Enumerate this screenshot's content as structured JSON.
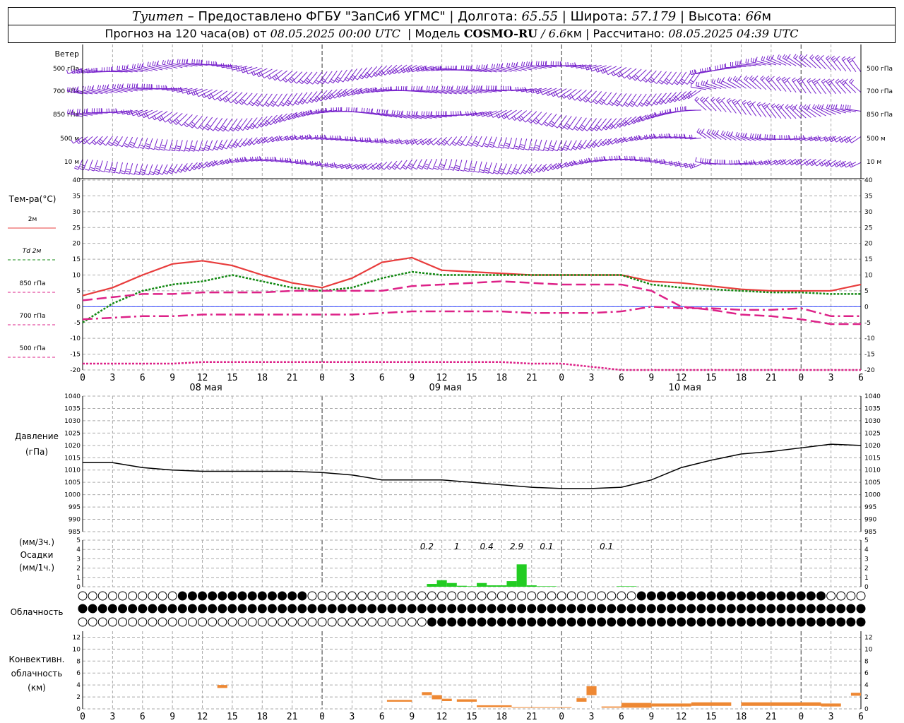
{
  "header": {
    "station": "Tyumen",
    "provider": "– Предоставлено ФГБУ \"ЗапСиб УГМС\"",
    "lon_label": "Долгота:",
    "lon": "65.55",
    "lat_label": "Широта:",
    "lat": "57.179",
    "alt_label": "Высота:",
    "alt": "66",
    "alt_unit": "м"
  },
  "subheader": {
    "forecast_label": "Прогноз на 120 часа(ов) от",
    "init": "08.05.2025 00:00 UTC",
    "model_label": "Модель",
    "model": "COSMO-RU",
    "resolution": "/ 6.6",
    "res_unit": "км",
    "calc_label": "Рассчитано:",
    "calc": "08.05.2025 04:39 UTC"
  },
  "panels": {
    "wind": {
      "title": "Ветер",
      "levels": [
        "500 гПа",
        "700 гПа",
        "850 гПа",
        "500 м",
        "10 м"
      ]
    },
    "temp": {
      "title": "Тем-ра(°C)",
      "legend": [
        "2м",
        "Td 2м",
        "850 гПа",
        "700 гПа",
        "500 гПа"
      ]
    },
    "pressure": {
      "title": "Давление",
      "unit": "(гПа)"
    },
    "precip": {
      "unit3h": "(мм/3ч.)",
      "title": "Осадки",
      "unit1h": "(мм/1ч.)"
    },
    "cloud": {
      "title": "Облачность"
    },
    "conv": {
      "title1": "Конвективн.",
      "title2": "облачность",
      "unit": "(км)"
    }
  },
  "x_ticks": [
    "0",
    "3",
    "6",
    "9",
    "12",
    "15",
    "18",
    "21",
    "0",
    "3",
    "6",
    "9",
    "12",
    "15",
    "18",
    "21",
    "0",
    "3",
    "6",
    "9",
    "12",
    "15",
    "18",
    "21",
    "0",
    "3",
    "6"
  ],
  "date_labels": [
    "08 мая",
    "09 мая",
    "10 мая"
  ],
  "colors": {
    "t2m": "#e83c3c",
    "td": "#118811",
    "lvl": "#dd2288",
    "wind": "#7722cc",
    "precip": "#22cc22",
    "conv": "#ee8833"
  },
  "chart_data": [
    {
      "type": "line",
      "name": "temperature",
      "ylim": [
        -20,
        40
      ],
      "yticks": [
        40,
        35,
        30,
        25,
        20,
        15,
        10,
        5,
        0,
        -5,
        -10,
        -15,
        -20
      ],
      "x": [
        0,
        3,
        6,
        9,
        12,
        15,
        18,
        21,
        24,
        27,
        30,
        33,
        36,
        39,
        42,
        45,
        48,
        51,
        54,
        57,
        60,
        63,
        66,
        69,
        72,
        75,
        78
      ],
      "series": [
        {
          "name": "2м",
          "values": [
            3.5,
            6,
            10,
            13.5,
            14.5,
            13,
            10,
            7.5,
            6,
            9,
            14,
            15.5,
            11.5,
            11,
            10.5,
            10,
            10,
            10,
            10,
            8,
            7.5,
            6.5,
            5.5,
            5,
            5,
            5,
            7
          ]
        },
        {
          "name": "Td 2м",
          "values": [
            -5,
            1,
            5,
            7,
            8,
            10,
            8,
            6,
            5,
            6,
            9,
            11,
            10,
            10,
            10,
            10,
            10,
            10,
            10,
            7,
            6,
            5.5,
            5,
            4.5,
            4.5,
            4,
            4
          ]
        },
        {
          "name": "850 гПа",
          "values": [
            2,
            3,
            4,
            4,
            4.5,
            4.5,
            4.5,
            5,
            5,
            5,
            5,
            6.5,
            7,
            7.5,
            8,
            7.5,
            7,
            7,
            7,
            5,
            0,
            -1,
            -2.5,
            -3,
            -4,
            -5.5,
            -5.5
          ]
        },
        {
          "name": "700 гПа",
          "values": [
            -4,
            -3.5,
            -3,
            -3,
            -2.5,
            -2.5,
            -2.5,
            -2.5,
            -2.5,
            -2.5,
            -2,
            -1.5,
            -1.5,
            -1.5,
            -1.5,
            -2,
            -2,
            -2,
            -1.5,
            0,
            -0.5,
            -0.5,
            -1,
            -1,
            -0.5,
            -3,
            -3
          ]
        },
        {
          "name": "500 гПа",
          "values": [
            -18,
            -18,
            -18,
            -18,
            -17.5,
            -17.5,
            -17.5,
            -17.5,
            -17.5,
            -17.5,
            -17.5,
            -17.5,
            -17.5,
            -17.5,
            -17.5,
            -18,
            -18,
            -19,
            -20,
            -20.5,
            -21,
            -21,
            -21,
            -21,
            -21,
            -21,
            -21
          ]
        }
      ]
    },
    {
      "type": "line",
      "name": "pressure",
      "ylim": [
        985,
        1040
      ],
      "yticks": [
        1040,
        1035,
        1030,
        1025,
        1020,
        1015,
        1010,
        1005,
        1000,
        995,
        990,
        985
      ],
      "x": [
        0,
        3,
        6,
        9,
        12,
        15,
        18,
        21,
        24,
        27,
        30,
        33,
        36,
        39,
        42,
        45,
        48,
        51,
        54,
        57,
        60,
        63,
        66,
        69,
        72,
        75,
        78
      ],
      "values": [
        1013,
        1013,
        1011,
        1010,
        1009.5,
        1009.5,
        1009.5,
        1009.5,
        1009,
        1008,
        1006,
        1006,
        1006,
        1005,
        1004,
        1003,
        1002.5,
        1002.5,
        1003,
        1006,
        1011,
        1014,
        1016.5,
        1017.5,
        1019,
        1020.5,
        1020
      ]
    },
    {
      "type": "bar",
      "name": "precipitation",
      "ylim": [
        0,
        5
      ],
      "yticks": [
        5,
        4,
        3,
        2,
        1,
        0
      ],
      "x": [
        35,
        36,
        37,
        38,
        39,
        40,
        41,
        42,
        43,
        44,
        45,
        46,
        47,
        48,
        49,
        50,
        51,
        52,
        53,
        54,
        55,
        56
      ],
      "values": [
        0.3,
        0.7,
        0.4,
        0.1,
        0.05,
        0.4,
        0.15,
        0.15,
        0.6,
        2.4,
        0.15,
        0.05,
        0.05,
        0,
        0,
        0,
        0,
        0,
        0,
        0.05,
        0.05,
        0
      ],
      "totals": [
        {
          "x": 34.5,
          "label": "0.2"
        },
        {
          "x": 37.5,
          "label": "1"
        },
        {
          "x": 40.5,
          "label": "0.4"
        },
        {
          "x": 43.5,
          "label": "2.9"
        },
        {
          "x": 46.5,
          "label": "0.1"
        },
        {
          "x": 52.5,
          "label": "0.1"
        }
      ]
    },
    {
      "type": "table",
      "name": "cloud_cover",
      "rows": [
        "0000000000111111111111100000000000000000000000000000000011111111111111111110000",
        "1111111111111111111111111111111111111111111111111111111111111111111111111111111",
        "0000000000000000000000000000000000011111111111111111111111111111111111111111111"
      ]
    },
    {
      "type": "bar",
      "name": "convective_cloud",
      "ylim": [
        0,
        13
      ],
      "yticks": [
        12,
        10,
        8,
        6,
        4,
        2,
        0
      ],
      "segments": [
        {
          "x0": 13.5,
          "x1": 14.5,
          "bottom": 3.5,
          "top": 4
        },
        {
          "x0": 30.5,
          "x1": 33,
          "bottom": 1.2,
          "top": 1.5
        },
        {
          "x0": 34,
          "x1": 35,
          "bottom": 2.3,
          "top": 2.8
        },
        {
          "x0": 35,
          "x1": 36,
          "bottom": 1.6,
          "top": 2.3
        },
        {
          "x0": 36,
          "x1": 37,
          "bottom": 1.3,
          "top": 1.7
        },
        {
          "x0": 37.5,
          "x1": 39.5,
          "bottom": 1.2,
          "top": 1.6
        },
        {
          "x0": 39.5,
          "x1": 43,
          "bottom": 0.3,
          "top": 0.6
        },
        {
          "x0": 43,
          "x1": 49,
          "bottom": 0.2,
          "top": 0.3
        },
        {
          "x0": 49.5,
          "x1": 50.5,
          "bottom": 1.2,
          "top": 1.8
        },
        {
          "x0": 50.5,
          "x1": 51.5,
          "bottom": 2.3,
          "top": 3.8
        },
        {
          "x0": 52,
          "x1": 54,
          "bottom": 0.2,
          "top": 0.4
        },
        {
          "x0": 54,
          "x1": 57,
          "bottom": 0.2,
          "top": 1
        },
        {
          "x0": 57,
          "x1": 61,
          "bottom": 0.4,
          "top": 0.9
        },
        {
          "x0": 61,
          "x1": 65,
          "bottom": 0.5,
          "top": 1.1
        },
        {
          "x0": 66,
          "x1": 69,
          "bottom": 0.5,
          "top": 1.1
        },
        {
          "x0": 69,
          "x1": 74,
          "bottom": 0.5,
          "top": 1.1
        },
        {
          "x0": 74,
          "x1": 76,
          "bottom": 0.4,
          "top": 0.9
        },
        {
          "x0": 77,
          "x1": 78,
          "bottom": 2.2,
          "top": 2.7
        }
      ]
    }
  ]
}
